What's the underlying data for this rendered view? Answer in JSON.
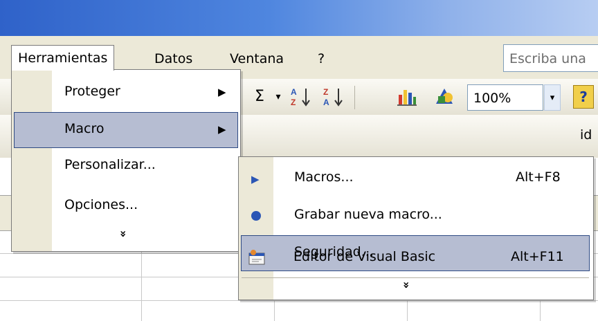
{
  "menubar": {
    "items": [
      "Herramientas",
      "Datos",
      "Ventana",
      "?"
    ],
    "search_placeholder": "Escriba una"
  },
  "toolbar": {
    "sum_glyph": "Σ",
    "dropdown_glyph": "▾",
    "zoom": "100%",
    "help_glyph": "?",
    "cut_off_text": "id"
  },
  "herramientas_menu": {
    "items": [
      {
        "label": "Proteger",
        "has_submenu": true,
        "highlighted": false
      },
      {
        "label": "Macro",
        "has_submenu": true,
        "highlighted": true
      },
      {
        "label": "Personalizar...",
        "has_submenu": false,
        "highlighted": false
      },
      {
        "label": "Opciones...",
        "has_submenu": false,
        "highlighted": false
      }
    ],
    "expand_glyph": "»"
  },
  "macro_submenu": {
    "items": [
      {
        "label": "Macros...",
        "shortcut": "Alt+F8",
        "icon": "run-macro-icon",
        "highlighted": false
      },
      {
        "label": "Grabar nueva macro...",
        "shortcut": "",
        "icon": "record-macro-icon",
        "highlighted": false
      },
      {
        "label": "Seguridad...",
        "shortcut": "",
        "icon": "",
        "highlighted": true
      },
      {
        "label": "Editor de Visual Basic",
        "shortcut": "Alt+F11",
        "icon": "vb-editor-icon",
        "highlighted": false
      }
    ],
    "expand_glyph": "»"
  },
  "colors": {
    "titlebar": "#2f62c9",
    "menubar": "#ece9d8",
    "highlight": "#b6bdd2",
    "highlight_border": "#2e4a83"
  }
}
